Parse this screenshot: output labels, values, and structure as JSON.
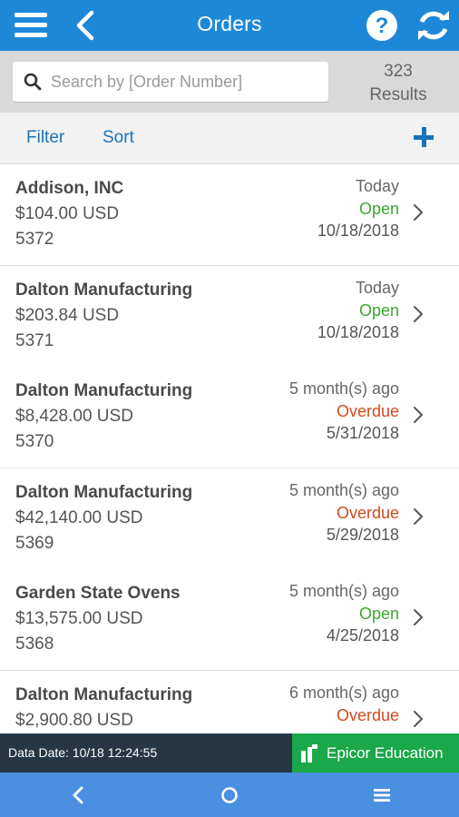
{
  "colors": {
    "appbar": "#1e88d8",
    "accent": "#1a73b8",
    "status_open": "#3aa72f",
    "status_overdue": "#d04a1c",
    "footer": "#263645",
    "education": "#1aa84b",
    "navbar": "#4a8fe0"
  },
  "appbar": {
    "title": "Orders",
    "icons": [
      "menu-icon",
      "back-icon",
      "help-icon",
      "refresh-icon"
    ]
  },
  "search": {
    "placeholder": "Search by [Order Number]",
    "value": "",
    "results_count": "323",
    "results_label": "Results"
  },
  "toolbar": {
    "filter_label": "Filter",
    "sort_label": "Sort",
    "add_icon": "plus-icon"
  },
  "orders": [
    {
      "customer": "Addison, INC",
      "amount": "$104.00 USD",
      "number": "5372",
      "ago": "Today",
      "status": "Open",
      "date": "10/18/2018"
    },
    {
      "customer": "Dalton Manufacturing",
      "amount": "$203.84 USD",
      "number": "5371",
      "ago": "Today",
      "status": "Open",
      "date": "10/18/2018"
    },
    {
      "customer": "Dalton Manufacturing",
      "amount": "$8,428.00 USD",
      "number": "5370",
      "ago": "5 month(s) ago",
      "status": "Overdue",
      "date": "5/31/2018"
    },
    {
      "customer": "Dalton Manufacturing",
      "amount": "$42,140.00 USD",
      "number": "5369",
      "ago": "5 month(s) ago",
      "status": "Overdue",
      "date": "5/29/2018"
    },
    {
      "customer": "Garden State Ovens",
      "amount": "$13,575.00 USD",
      "number": "5368",
      "ago": "5 month(s) ago",
      "status": "Open",
      "date": "4/25/2018"
    },
    {
      "customer": "Dalton Manufacturing",
      "amount": "$2,900.80 USD",
      "number": "",
      "ago": "6 month(s) ago",
      "status": "Overdue",
      "date": ""
    }
  ],
  "footer": {
    "data_date": "Data Date: 10/18 12:24:55",
    "education_label": "Epicor Education"
  },
  "navbar": {
    "icons": [
      "nav-back-icon",
      "nav-home-icon",
      "nav-menu-icon"
    ]
  }
}
